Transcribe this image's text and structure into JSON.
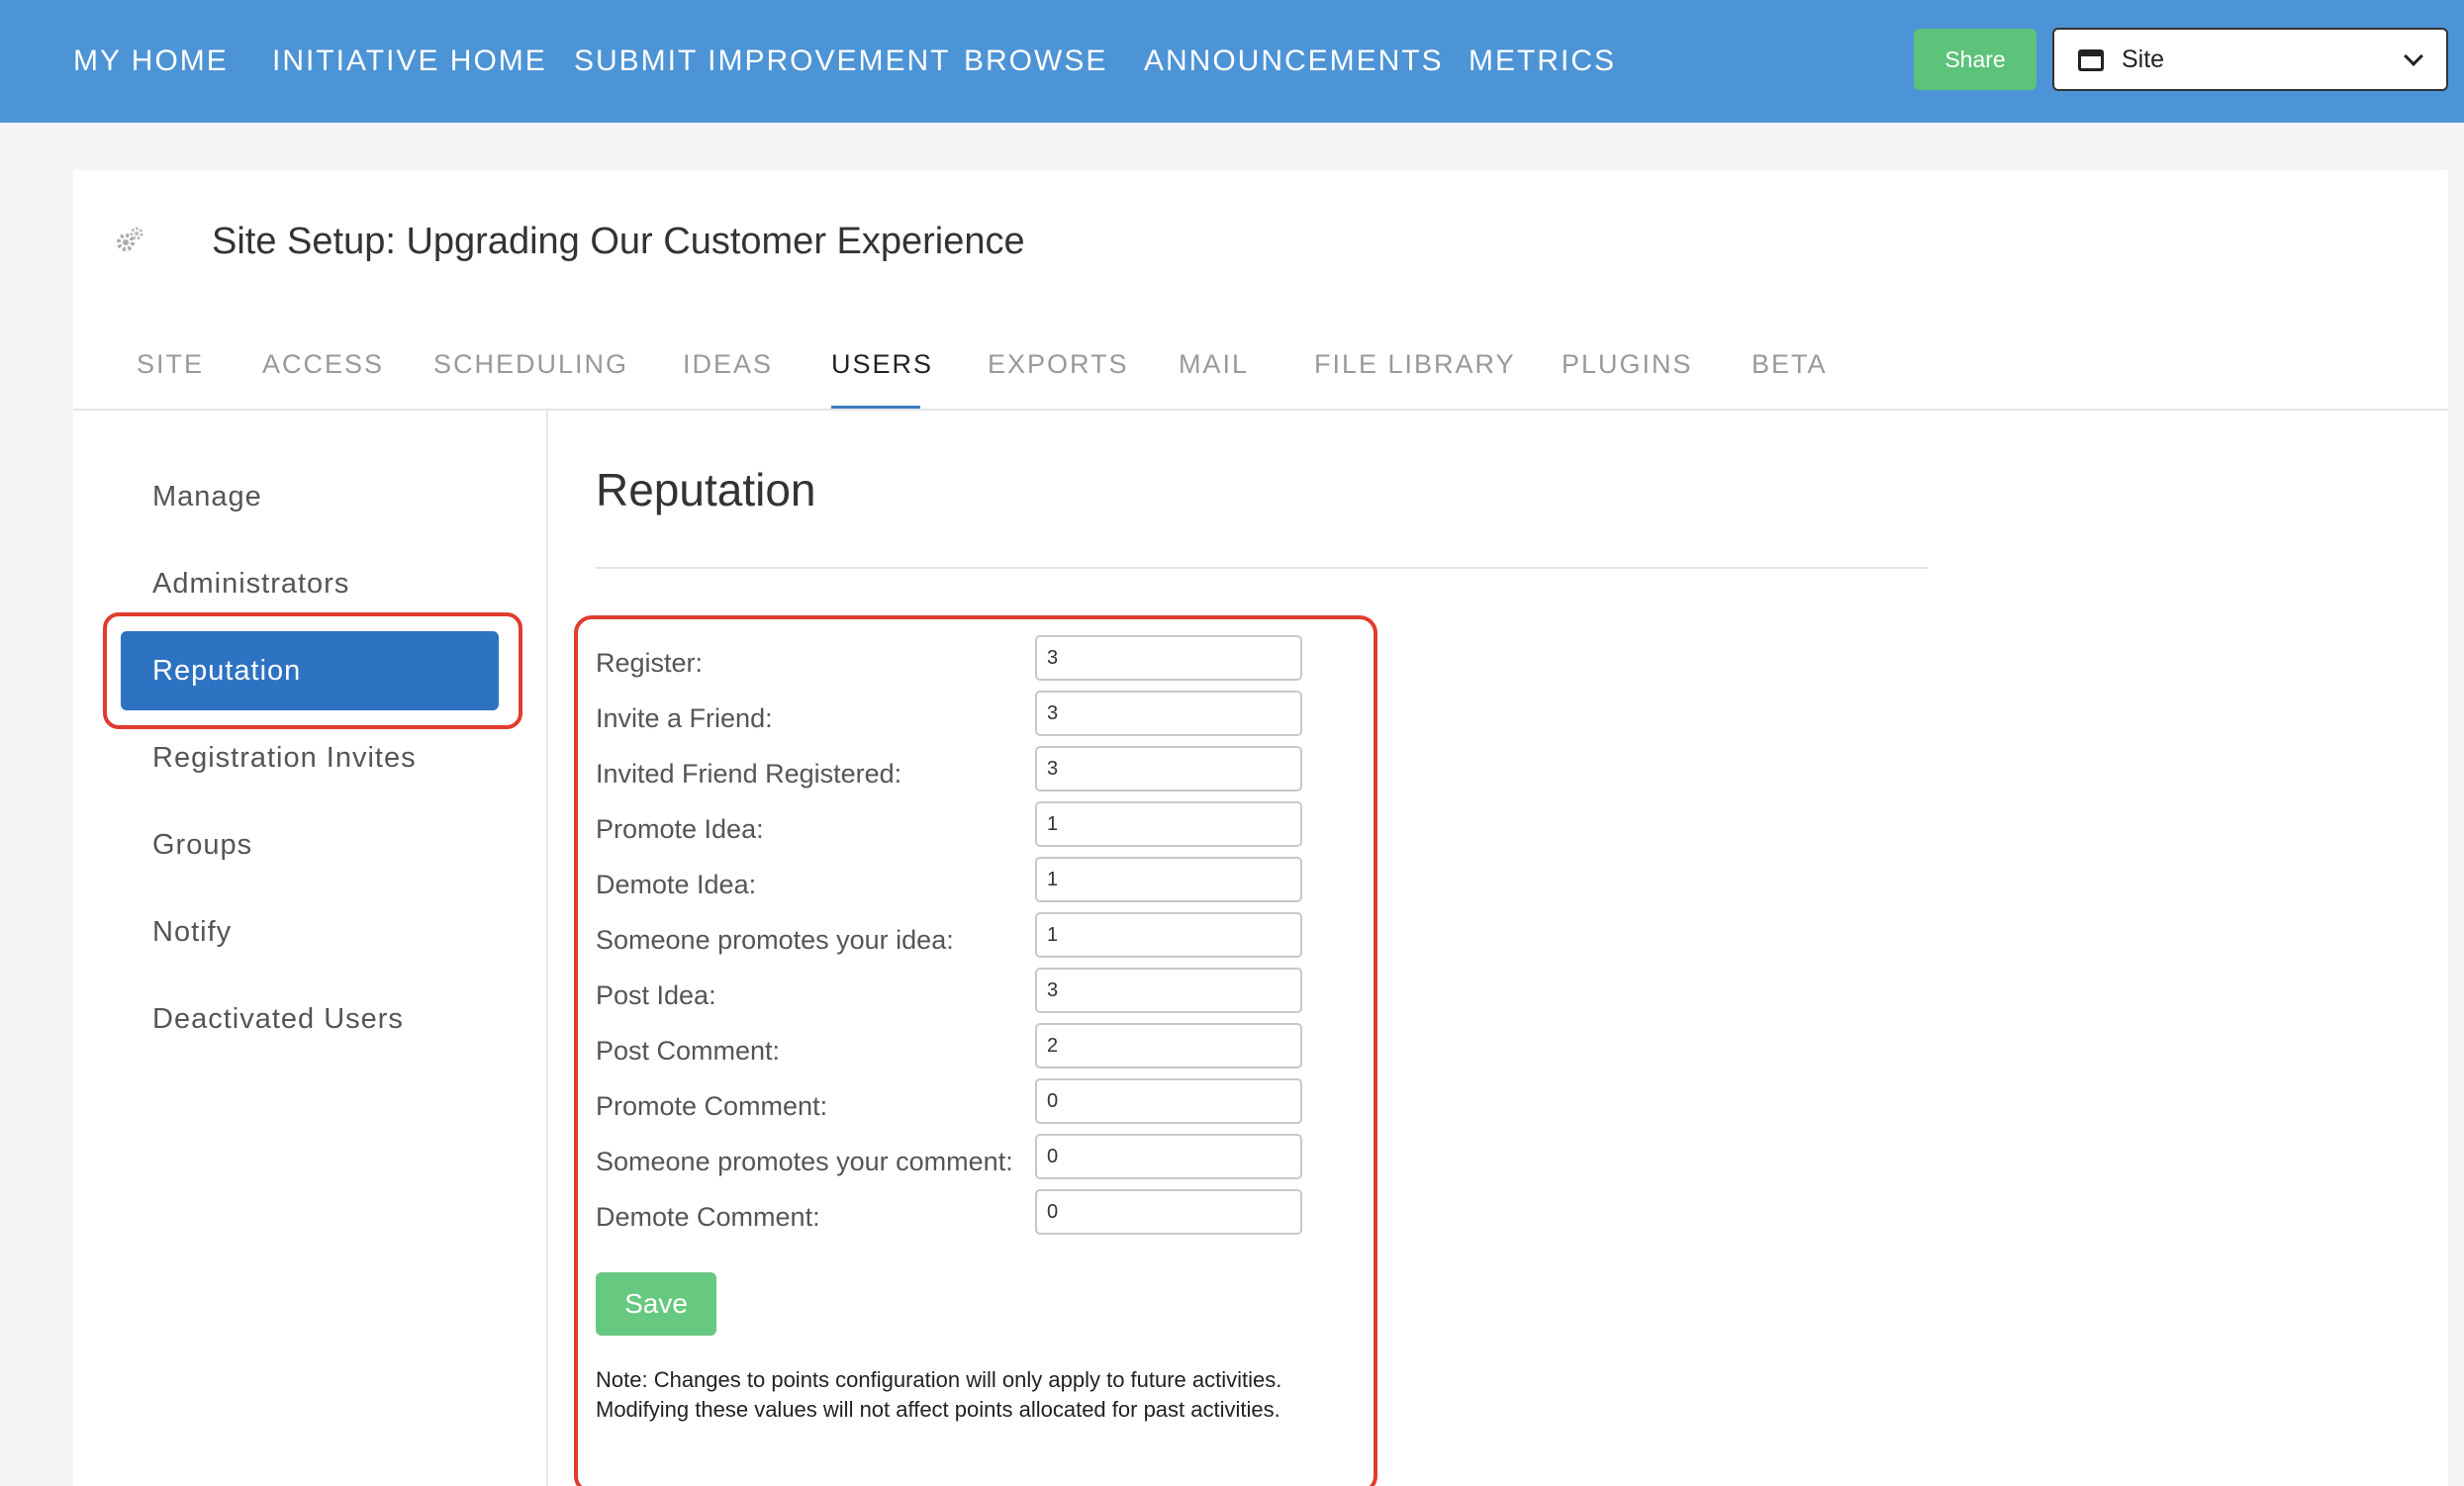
{
  "topnav": {
    "items": [
      "MY HOME",
      "INITIATIVE HOME",
      "SUBMIT IMPROVEMENT",
      "BROWSE",
      "ANNOUNCEMENTS",
      "METRICS"
    ],
    "share_label": "Share",
    "site_select_value": "Site"
  },
  "page": {
    "title": "Site Setup: Upgrading Our Customer Experience",
    "tabs": [
      "SITE",
      "ACCESS",
      "SCHEDULING",
      "IDEAS",
      "USERS",
      "EXPORTS",
      "MAIL",
      "FILE LIBRARY",
      "PLUGINS",
      "BETA"
    ],
    "active_tab": "USERS"
  },
  "sidebar": {
    "items": [
      "Manage",
      "Administrators",
      "Reputation",
      "Registration Invites",
      "Groups",
      "Notify",
      "Deactivated Users"
    ],
    "active": "Reputation"
  },
  "reputation": {
    "title": "Reputation",
    "fields": [
      {
        "label": "Register:",
        "value": "3"
      },
      {
        "label": "Invite a Friend:",
        "value": "3"
      },
      {
        "label": "Invited Friend Registered:",
        "value": "3"
      },
      {
        "label": "Promote Idea:",
        "value": "1"
      },
      {
        "label": "Demote Idea:",
        "value": "1"
      },
      {
        "label": "Someone promotes your idea:",
        "value": "1"
      },
      {
        "label": "Post Idea:",
        "value": "3"
      },
      {
        "label": "Post Comment:",
        "value": "2"
      },
      {
        "label": "Promote Comment:",
        "value": "0"
      },
      {
        "label": "Someone promotes your comment:",
        "value": "0"
      },
      {
        "label": "Demote Comment:",
        "value": "0"
      }
    ],
    "save_label": "Save",
    "note_line1": "Note: Changes to points configuration will only apply to future activities.",
    "note_line2": "Modifying these values will not affect points allocated for past activities."
  },
  "colors": {
    "nav_bg": "#4d94d6",
    "share_green": "#5dc27a",
    "active_blue": "#2e72c2",
    "highlight_red": "#e03c2f",
    "save_green": "#67c97f"
  }
}
